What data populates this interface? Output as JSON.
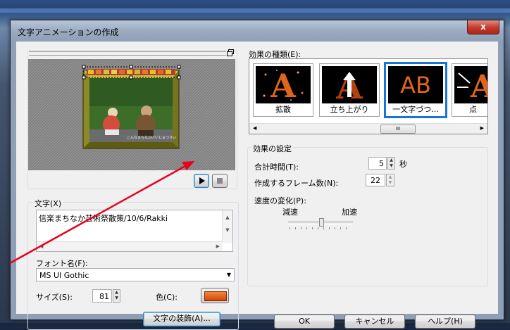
{
  "dialog": {
    "title": "文字アニメーションの作成",
    "close_label": "x"
  },
  "preview": {
    "caption": "こんなまちなかげいじゅつさい"
  },
  "effects": {
    "label": "効果の種類(E):",
    "items": [
      {
        "label": "拡散",
        "selected": false,
        "icon": "scatter-A-icon"
      },
      {
        "label": "立ち上がり",
        "selected": false,
        "icon": "rise-A-icon"
      },
      {
        "label": "一文字づつ...",
        "selected": true,
        "icon": "AB-per-char-icon"
      },
      {
        "label": "点",
        "selected": false,
        "icon": "point-A-icon"
      }
    ],
    "scroll_grip": "III"
  },
  "settings": {
    "label": "効果の設定",
    "total_time_label": "合計時間(T):",
    "total_time_value": "5",
    "total_time_unit": "秒",
    "frames_label": "作成するフレーム数(N):",
    "frames_value": "22",
    "speed_label": "速度の変化(P):",
    "decel_label": "減速",
    "accel_label": "加速"
  },
  "text": {
    "label": "文字(X)",
    "value": "信楽まちなか芸術祭散策/10/6/Rakki"
  },
  "font": {
    "label": "フォント名(F):",
    "value": "MS UI Gothic",
    "size_label": "サイズ(S):",
    "size_value": "81",
    "color_label": "色(C):",
    "color": "#e05a10"
  },
  "buttons": {
    "decorate": "文字の装飾(A)...",
    "ok": "OK",
    "cancel": "キャンセル",
    "help": "ヘルプ(H)"
  },
  "annotation_color": "#e8001c"
}
